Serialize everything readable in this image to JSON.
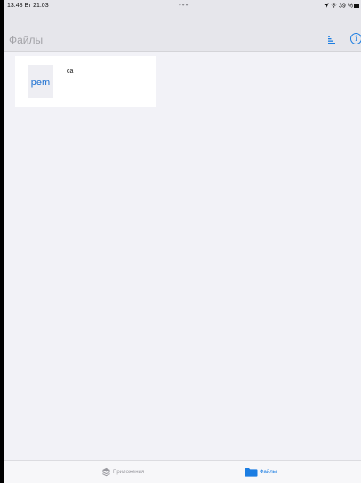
{
  "status_bar": {
    "time": "13:48",
    "date": "Вт 21.03",
    "dots": "•••",
    "battery_text": "39 %"
  },
  "nav": {
    "title": "Файлы"
  },
  "files": [
    {
      "name": "са",
      "extension": "pem"
    }
  ],
  "tabs": [
    {
      "label": "Приложения",
      "icon": "layers-icon",
      "active": false
    },
    {
      "label": "Файлы",
      "icon": "folder-icon",
      "active": true
    }
  ],
  "colors": {
    "accent": "#1b7de2",
    "bar_background": "#e6e6eb",
    "content_background": "#f2f2f7"
  }
}
